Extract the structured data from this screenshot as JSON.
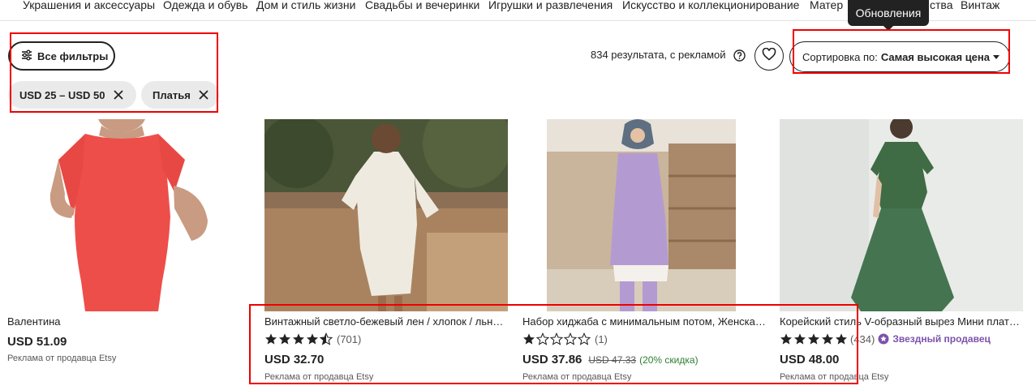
{
  "top_nav": [
    "Украшения и аксессуары",
    "Одежда и обувь",
    "Дом и стиль жизни",
    "Свадьбы и вечеринки",
    "Игрушки и развлечения",
    "Искусство и коллекционирование",
    "Матер",
    "ства",
    "Винтаж"
  ],
  "tooltip": "Обновления",
  "filters": {
    "all_filters_label": "Все фильтры",
    "chips": [
      "USD 25 – USD 50",
      "Платья"
    ]
  },
  "results": {
    "count_text": "834 результата, с рекламой"
  },
  "sort": {
    "label": "Сортировка по:",
    "value": "Самая высокая цена"
  },
  "colors": {
    "accent_red": "#e00000",
    "star_seller": "#7b52ab",
    "discount": "#2f7d32"
  },
  "products": [
    {
      "title": "Валентина",
      "price": "USD 51.09",
      "ad": "Реклама от продавца Etsy"
    },
    {
      "title": "Винтажный светло-бежевый лен / хлопок / льняная рубашка",
      "rating": 4.5,
      "reviews": "(701)",
      "price": "USD 32.70",
      "ad": "Реклама от продавца Etsy"
    },
    {
      "title": "Набор хиджаба с минимальным потом, Женская одежда",
      "rating": 1,
      "reviews": "(1)",
      "price": "USD 37.86",
      "old_price": "USD 47.33",
      "discount": "(20% скидка)",
      "ad": "Реклама от продавца Etsy"
    },
    {
      "title": "Корейский стиль V-образный вырез Мини платье",
      "rating": 5,
      "reviews": "(434)",
      "badge": "Звездный продавец",
      "price": "USD 48.00",
      "ad": "Реклама от продавца Etsy"
    }
  ]
}
